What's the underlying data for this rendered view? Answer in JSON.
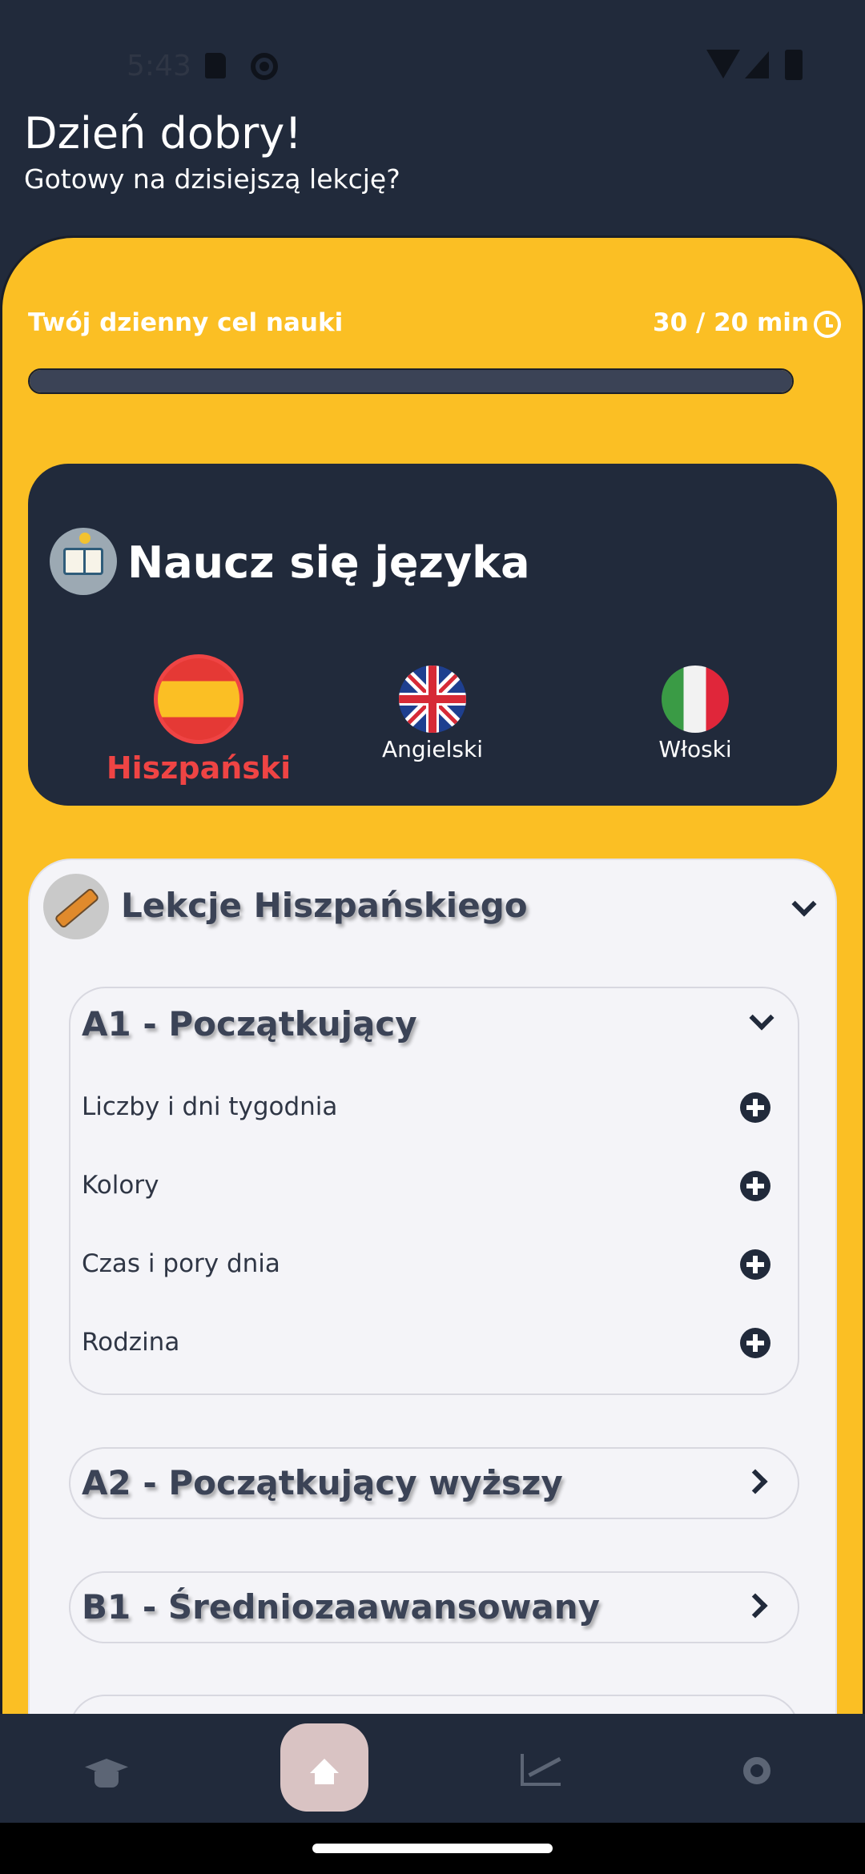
{
  "status_bar": {
    "time": "5:43"
  },
  "header": {
    "greeting": "Dzień dobry!",
    "subtitle": "Gotowy na dzisiejszą lekcję?"
  },
  "goal": {
    "label": "Twój dzienny cel nauki",
    "value": "30 / 20 min",
    "progress": 1.0
  },
  "language_card": {
    "title": "Naucz się języka",
    "languages": [
      {
        "name": "Hiszpański",
        "active": true,
        "flag": "spain-flag"
      },
      {
        "name": "Angielski",
        "active": false,
        "flag": "uk-flag"
      },
      {
        "name": "Włoski",
        "active": false,
        "flag": "italy-flag"
      }
    ]
  },
  "lessons": {
    "title": "Lekcje Hiszpańskiego",
    "levels": [
      {
        "title": "A1 - Początkujący",
        "expanded": true,
        "items": [
          "Liczby i dni tygodnia",
          "Kolory",
          "Czas i pory dnia",
          "Rodzina"
        ]
      },
      {
        "title": "A2 - Początkujący wyższy",
        "expanded": false
      },
      {
        "title": "B1 - Średniozaawansowany",
        "expanded": false
      }
    ]
  },
  "nav": {
    "items": [
      "graduation-cap-icon",
      "home-icon",
      "chart-icon",
      "settings-icon"
    ],
    "active": "home-icon"
  },
  "colors": {
    "background": "#212a3b",
    "accent": "#fbbf24",
    "active_language": "#ef4444",
    "card": "#f4f4f8"
  }
}
